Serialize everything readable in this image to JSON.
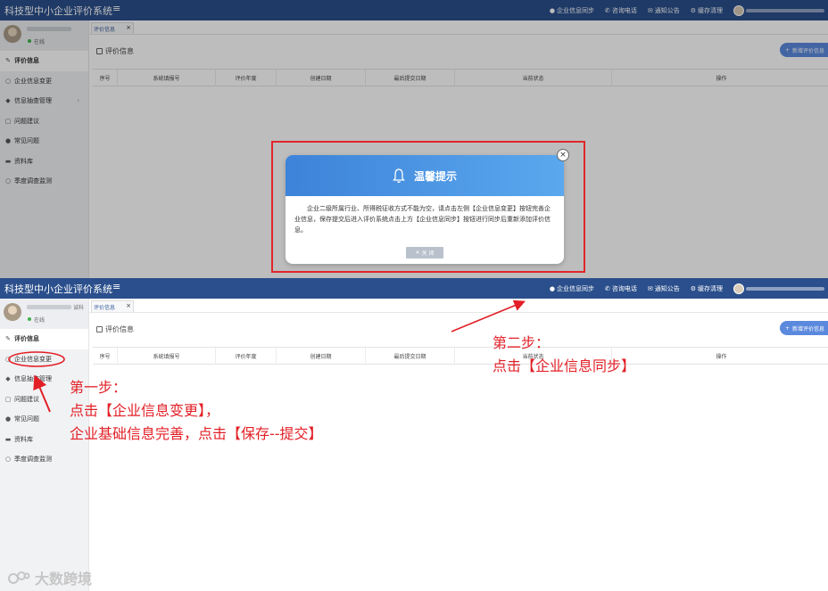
{
  "app": {
    "title": "科技型中小企业评价系统",
    "menu_icon": "menu-icon"
  },
  "topnav": {
    "sync": "企业信息同步",
    "phone": "咨询电话",
    "notice": "通知公告",
    "cache": "缓存清理"
  },
  "profile": {
    "name_suffix": "诚科",
    "status": "在线"
  },
  "sidebar": {
    "items": [
      {
        "label": "评价信息",
        "icon": "edit-icon"
      },
      {
        "label": "企业信息变更",
        "icon": "circle-icon"
      },
      {
        "label": "信息抽查管理",
        "icon": "tag-icon"
      },
      {
        "label": "问题建议",
        "icon": "comment-icon"
      },
      {
        "label": "常见问题",
        "icon": "question-icon"
      },
      {
        "label": "资料库",
        "icon": "folder-icon"
      },
      {
        "label": "季度调查监测",
        "icon": "circle-icon"
      }
    ]
  },
  "tab": {
    "label": "评价信息",
    "close": "×"
  },
  "page": {
    "title": "评价信息",
    "add_button": "新增评价信息"
  },
  "table": {
    "columns": [
      "序号",
      "系统填报号",
      "评价年度",
      "创建日期",
      "最后提交日期",
      "当前状态",
      "操作"
    ]
  },
  "dialog": {
    "title": "温馨提示",
    "body": "企业二级所属行业、所得税征收方式不能为空，请点击左侧【企业信息变更】按钮完善企业信息，保存提交后进入评价系统点击上方【企业信息同步】按钮进行同步后重新添加评价信息。",
    "close_button": "关 闭"
  },
  "annotations": {
    "step1_title": "第一步：",
    "step1_line1": "点击【企业信息变更】，",
    "step1_line2": "企业基础信息完善，点击【保存--提交】",
    "step2_title": "第二步：",
    "step2_line1": "点击【企业信息同步】"
  },
  "watermark": "大数跨境",
  "colors": {
    "topbar": "#2b4f8c",
    "annotation_red": "#e21f26",
    "dialog_header": "#4a93e3",
    "add_button": "#5b89dd"
  }
}
